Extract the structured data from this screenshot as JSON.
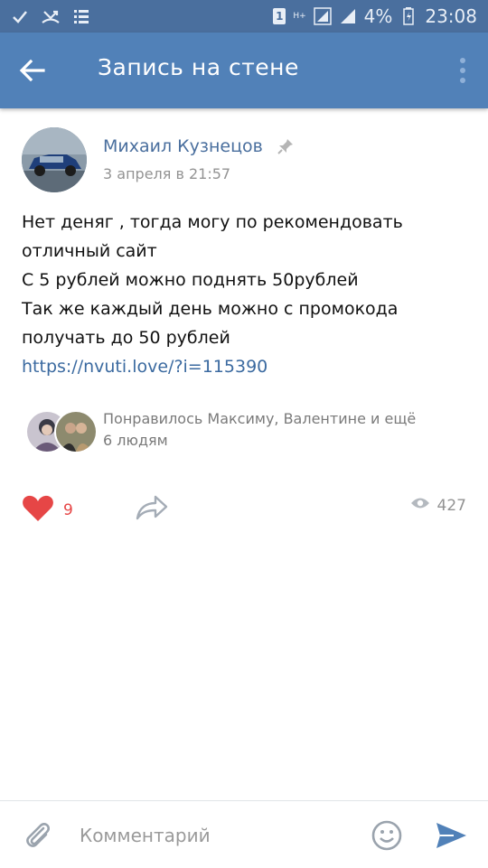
{
  "status_bar": {
    "sim_slot": "1",
    "network": "H+",
    "battery_percent": "4%",
    "time": "23:08"
  },
  "app_bar": {
    "title": "Запись на стене"
  },
  "post": {
    "author": "Михаил Кузнецов",
    "date": "3 апреля в 21:57",
    "text_lines": [
      "Нет деняг , тогда могу по рекомендовать",
      "отличный сайт",
      "С 5 рублей можно поднять 50рублей",
      "Так же каждый день можно с промокода",
      "получать до 50 рублей"
    ],
    "link": "https://nvuti.love/?i=115390",
    "liked_by_line1": "Понравилось Максиму, Валентине и ещё",
    "liked_by_line2": "6 людям",
    "likes_count": "9",
    "views_count": "427"
  },
  "comment_bar": {
    "placeholder": "Комментарий"
  },
  "colors": {
    "status_bar": "#4a6f9e",
    "app_bar": "#5181b8",
    "author": "#4a6f9e",
    "like": "#e64646",
    "send": "#5181b8"
  },
  "icons": {
    "back": "arrow-left",
    "more": "vertical-dots",
    "pin": "pin",
    "like": "heart",
    "share": "share-arrow",
    "views": "eye",
    "attach": "paperclip",
    "emoji": "smiley",
    "send": "paper-plane"
  }
}
